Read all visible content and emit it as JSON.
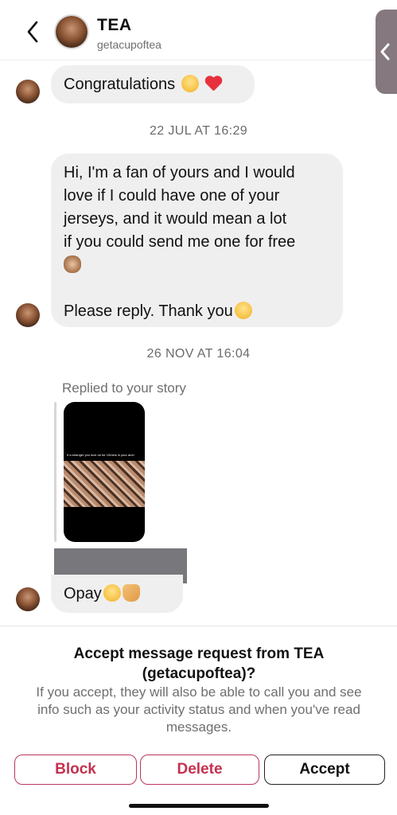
{
  "header": {
    "title": "TEA",
    "username": "getacupoftea",
    "back_icon": "chevron-left-icon",
    "side_handle_icon": "chevron-left-icon"
  },
  "messages": [
    {
      "type": "text",
      "text": "Congratulations",
      "emojis": [
        "face-with-tears-of-joy",
        "red-heart"
      ]
    },
    {
      "type": "timestamp",
      "text": "22 JUL AT 16:29"
    },
    {
      "type": "text",
      "lines": [
        "Hi, I'm a fan of yours and I would",
        "love if I could have one of your",
        "jerseys, and it would mean a lot",
        "if you could send me one for free"
      ],
      "emoji_line": "see-no-evil-monkey",
      "closing": "Please reply. Thank you",
      "closing_emoji": "loudly-crying-face"
    },
    {
      "type": "timestamp",
      "text": "26 NOV AT 16:04"
    },
    {
      "type": "story_reply",
      "label": "Replied to your story",
      "story_caption": "If a stranger you love do for 10mins in your arch"
    },
    {
      "type": "text",
      "text": "Opay",
      "emojis": [
        "pensive-face",
        "heart-hands"
      ]
    }
  ],
  "request": {
    "title": "Accept message request from TEA (getacupoftea)?",
    "body": "If you accept, they will also be able to call you and see info such as your activity status and when you've read messages.",
    "buttons": {
      "block": "Block",
      "delete": "Delete",
      "accept": "Accept"
    }
  },
  "colors": {
    "bubble": "#efefef",
    "danger": "#c4314f",
    "muted_text": "#6f6f6f",
    "side_handle": "#85787e"
  }
}
